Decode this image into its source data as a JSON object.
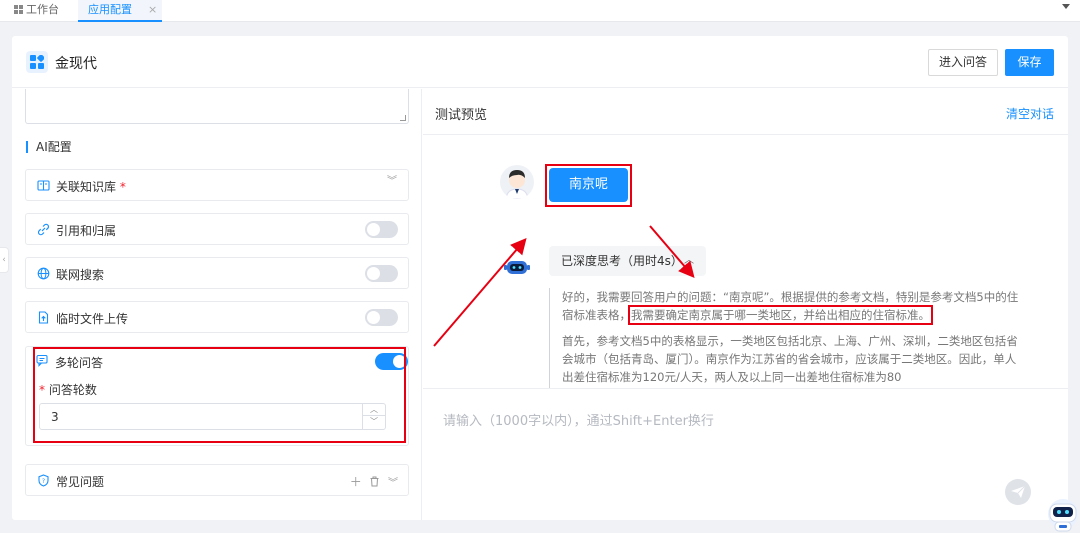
{
  "tabs": [
    {
      "label": "工作台",
      "icon": "grid-icon"
    },
    {
      "label": "应用配置",
      "active": true,
      "close": "×"
    }
  ],
  "header": {
    "app_name": "金现代",
    "enter_qa_label": "进入问答",
    "save_label": "保存"
  },
  "left": {
    "section_title": "AI配置",
    "knowledge_base": {
      "label": "关联知识库",
      "required_mark": "*"
    },
    "citation": {
      "label": "引用和归属",
      "enabled": false
    },
    "web_search": {
      "label": "联网搜索",
      "enabled": false
    },
    "temp_upload": {
      "label": "临时文件上传",
      "enabled": false
    },
    "multi_turn": {
      "label": "多轮问答",
      "enabled": true,
      "rounds_label": "问答轮数",
      "required_mark": "*",
      "rounds_value": "3"
    },
    "faq": {
      "label": "常见问题"
    }
  },
  "preview": {
    "title": "测试预览",
    "clear_label": "清空对话",
    "user_message": "南京呢",
    "thinking_label": "已深度思考（用时4s）",
    "reasoning_1a": "好的，我需要回答用户的问题：“南京呢”。根据提供的参考文档，特别是参考文档5中的住宿标准表格，",
    "reasoning_1b": "我需要确定南京属于哪一类地区，并给出相应的住宿标准。",
    "reasoning_2": "首先，参考文档5中的表格显示，一类地区包括北京、上海、广州、深圳，二类地区包括省会城市（包括青岛、厦门）。南京作为江苏省的省会城市，应该属于二类地区。因此，单人出差住宿标准为120元/人天，两人及以上同一出差地住宿标准为80",
    "input_placeholder": "请输入（1000字以内），通过Shift+Enter换行"
  },
  "colors": {
    "accent": "#1890ff",
    "annotation": "#e60012"
  }
}
